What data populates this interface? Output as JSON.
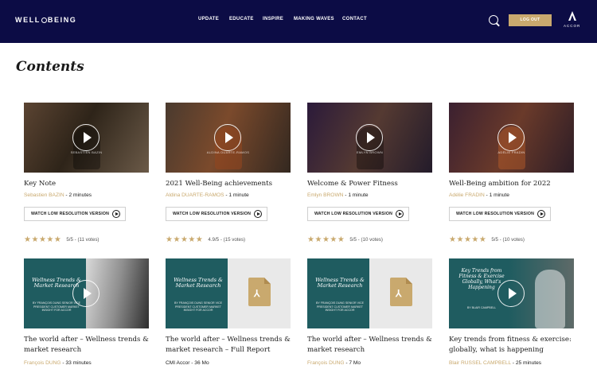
{
  "header": {
    "logo_left": "WELL",
    "logo_right": "BEING",
    "nav": [
      "UPDATE",
      "EDUCATE",
      "INSPIRE",
      "MAKING WAVES",
      "CONTACT"
    ],
    "logout_label": "LOG OUT",
    "brand": "ACCOR"
  },
  "page": {
    "title": "Contents"
  },
  "cards": [
    {
      "title": "Key Note",
      "author": "Sebastien BAZIN",
      "sep": " - ",
      "duration": "2 minutes",
      "watch_label": "WATCH LOW RESOLUTION VERSION",
      "rating": 5,
      "rating_text": "5/5 - (11 votes)",
      "caption": "SEBASTIEN BAZIN"
    },
    {
      "title": "2021 Well-Being achievements",
      "author": "Aldina DUARTE-RAMOS",
      "sep": " - ",
      "duration": "1 minute",
      "watch_label": "WATCH LOW RESOLUTION VERSION",
      "rating": 4.9,
      "rating_text": "4.9/5 - (15 votes)",
      "caption": "ALDINA DUARTE-RAMOS"
    },
    {
      "title": "Welcome & Power Fitness",
      "author": "Emlyn BROWN",
      "sep": " - ",
      "duration": "1 minute",
      "watch_label": "WATCH LOW RESOLUTION VERSION",
      "rating": 5,
      "rating_text": "5/5 - (10 votes)",
      "caption": "EMLYN BROWN"
    },
    {
      "title": "Well-Being ambition for 2022",
      "author": "Adélie FRADIN",
      "sep": " - ",
      "duration": "1 minute",
      "watch_label": "WATCH LOW RESOLUTION VERSION",
      "rating": 5,
      "rating_text": "5/5 - (10 votes)",
      "caption": "ADÉLIE FRADIN"
    },
    {
      "title_l1": "The world after – Wellness trends &",
      "title_l2": "market research",
      "author": "François DUNG",
      "sep": " - ",
      "duration": "33 minutes",
      "thumb_title": "Wellness Trends & Market Research",
      "thumb_by": "BY FRANÇOIS DUNG SENIOR VICE PRESIDENT CUSTOMER MARKET INSIGHT FOR ACCOR"
    },
    {
      "title_l1": "The world after – Wellness trends &",
      "title_l2": "market research – Full Report",
      "author": "CMI Accor",
      "sep": " - ",
      "duration": "36 Mo",
      "thumb_title": "Wellness Trends & Market Research",
      "thumb_by": "BY FRANÇOIS DUNG SENIOR VICE PRESIDENT CUSTOMER MARKET INSIGHT FOR ACCOR"
    },
    {
      "title_l1": "The world after – Wellness trends &",
      "title_l2": "market research",
      "author": "François DUNG",
      "sep": " - ",
      "duration": "7 Mo",
      "thumb_title": "Wellness Trends & Market Research",
      "thumb_by": "BY FRANÇOIS DUNG SENIOR VICE PRESIDENT CUSTOMER MARKET INSIGHT FOR ACCOR"
    },
    {
      "title_l1": "Key trends from fitness & exercise:",
      "title_l2": "globally, what is happening",
      "author": "Blair RUSSEL CAMPBELL",
      "sep": " - ",
      "duration": "25 minutes",
      "thumb_title": "Key Trends from Fitness & Exercise Globally, What's Happening",
      "thumb_by": "BY BLAIR CAMPBELL"
    }
  ],
  "colors": {
    "header_bg": "#0c0c45",
    "accent": "#c9a96e",
    "teal": "#1f5c60"
  }
}
